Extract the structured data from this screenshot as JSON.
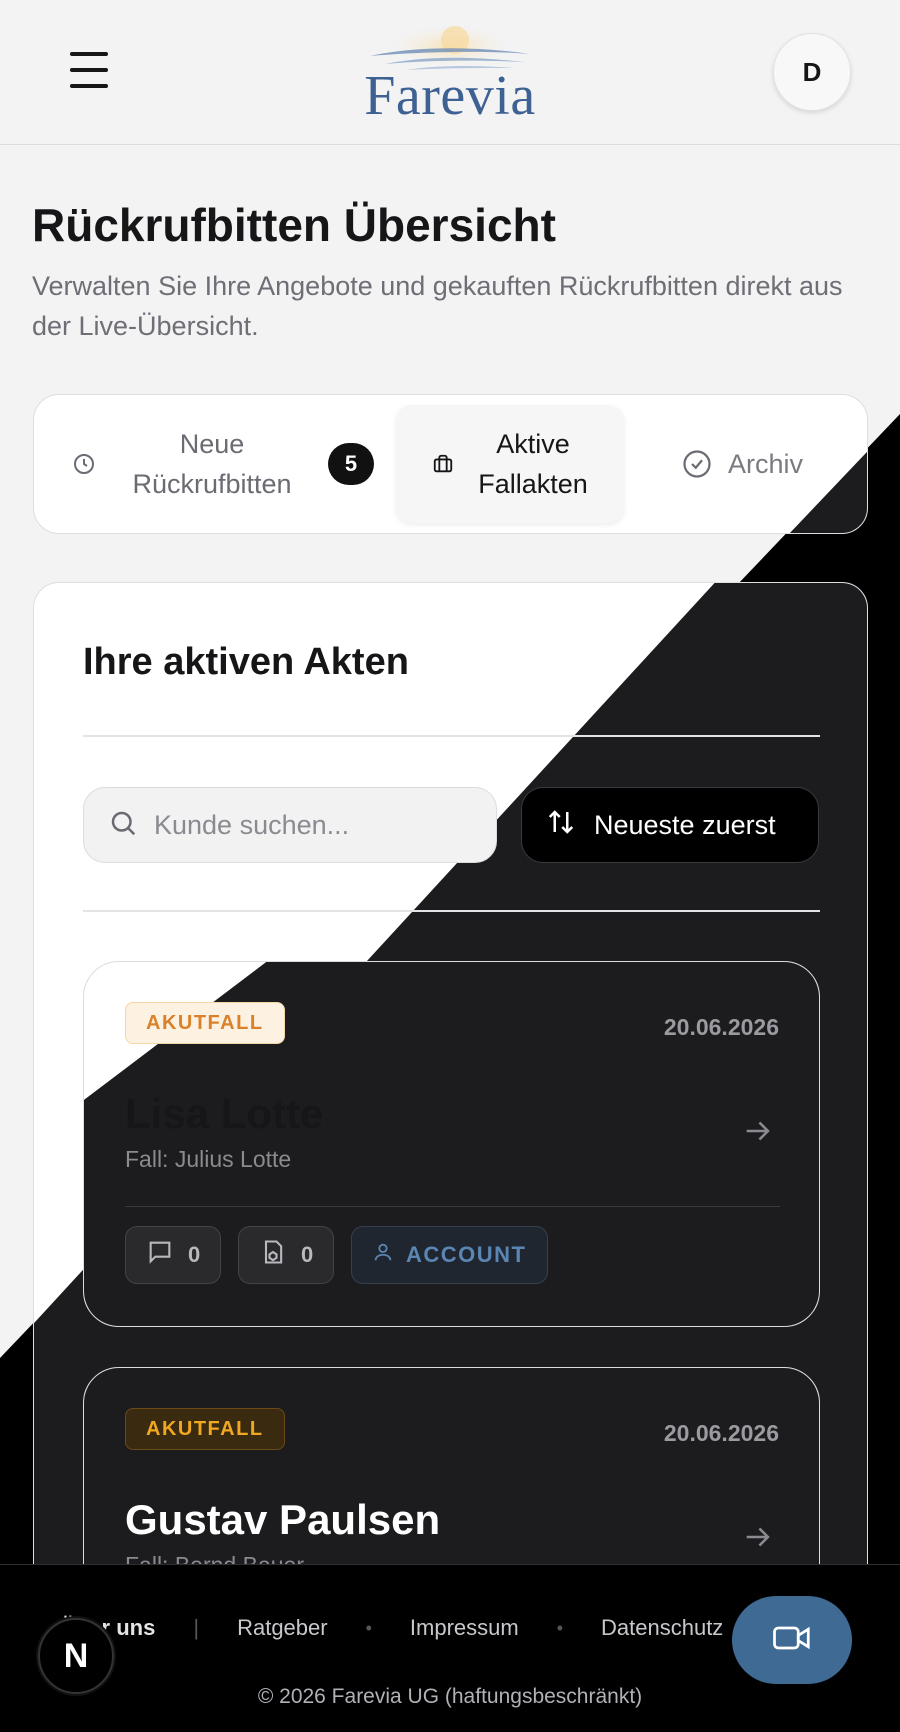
{
  "header": {
    "brand": "Farevia",
    "avatar_initial": "D"
  },
  "page": {
    "title": "Rückrufbitten Übersicht",
    "subtitle": "Verwalten Sie Ihre Angebote und gekauften Rückrufbitten direkt aus der Live-Übersicht."
  },
  "tabs": [
    {
      "label_line1": "Neue",
      "label_line2": "Rückrufbitten",
      "badge": "5",
      "icon": "clock-icon"
    },
    {
      "label_line1": "Aktive",
      "label_line2": "Fallakten",
      "icon": "briefcase-icon",
      "active": true
    },
    {
      "label": "Archiv",
      "icon": "check-circle-icon"
    }
  ],
  "main": {
    "section_title": "Ihre aktiven Akten",
    "search_placeholder": "Kunde suchen...",
    "sort_label": "Neueste zuerst"
  },
  "cases": [
    {
      "tag": "AKUTFALL",
      "date": "20.06.2026",
      "name": "Lisa Lotte",
      "sub": "Fall: Julius Lotte",
      "messages": "0",
      "documents": "0",
      "account": "ACCOUNT"
    },
    {
      "tag": "AKUTFALL",
      "date": "20.06.2026",
      "name": "Gustav Paulsen",
      "sub": "Fall: Bernd Bauer"
    }
  ],
  "footer": {
    "links": [
      "Über uns",
      "Ratgeber",
      "Impressum",
      "Datenschutz"
    ],
    "copyright": "© 2026 Farevia UG (haftungsbeschränkt)"
  },
  "colors": {
    "brand_blue": "#3e6193",
    "tag_orange": "#d9822b",
    "dark_bg": "#1c1c1e"
  }
}
